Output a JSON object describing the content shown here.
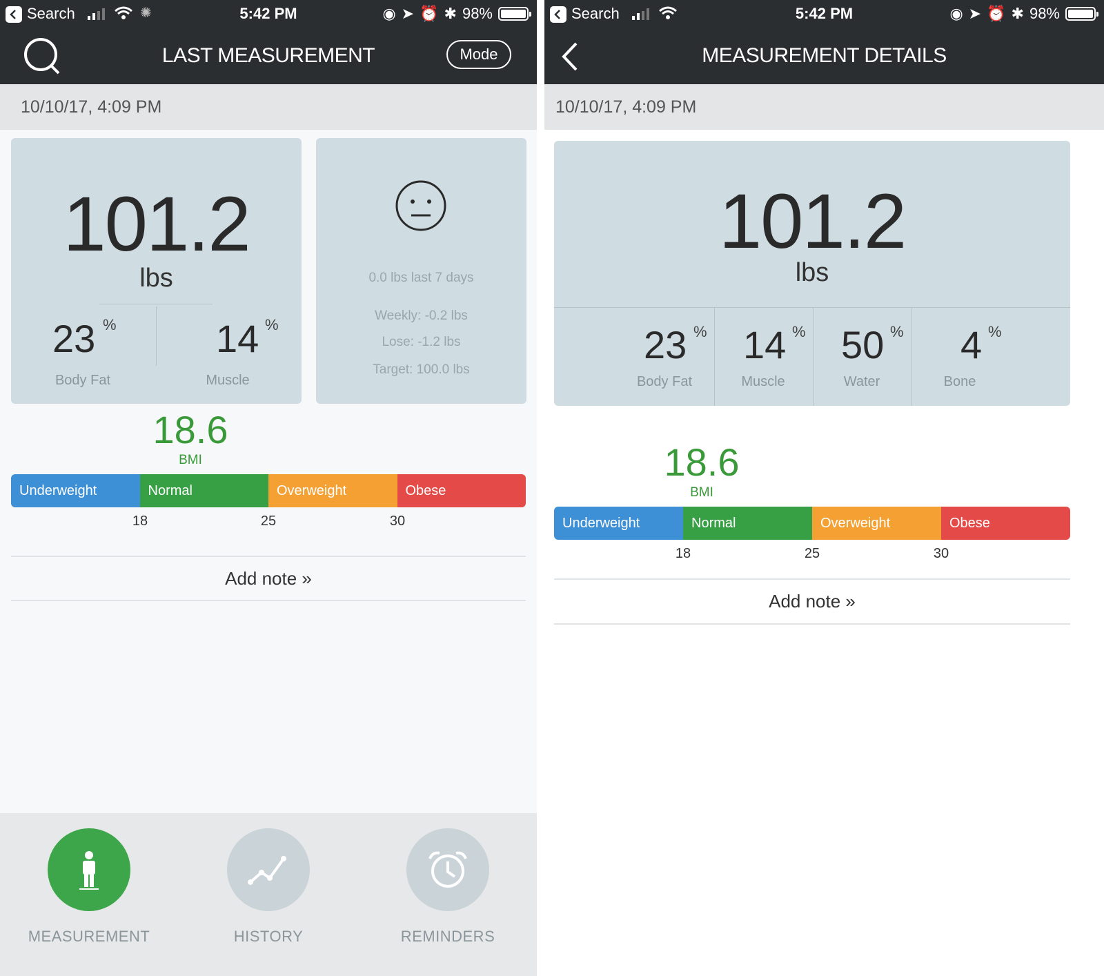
{
  "status_bar": {
    "carrier": "Search",
    "time": "5:42 PM",
    "battery": "98%",
    "battery_level": 0.98
  },
  "left": {
    "nav_title": "LAST MEASUREMENT",
    "mode_label": "Mode",
    "date": "10/10/17, 4:09 PM",
    "weight": "101.2",
    "unit": "lbs",
    "stats": [
      {
        "value": "23",
        "pct": "%",
        "label": "Body Fat"
      },
      {
        "value": "14",
        "pct": "%",
        "label": "Muscle"
      }
    ],
    "mood": {
      "change": "0.0 lbs last 7 days",
      "weekly": "Weekly: -0.2 lbs",
      "lose": "Lose: -1.2 lbs",
      "target": "Target: 100.0 lbs"
    },
    "bmi_value": "18.6",
    "bmi_label": "BMI",
    "add_note": "Add note »",
    "tabs": [
      {
        "label": "MEASUREMENT",
        "icon": "person-icon",
        "active": true
      },
      {
        "label": "HISTORY",
        "icon": "trend-line-icon",
        "active": false
      },
      {
        "label": "REMINDERS",
        "icon": "alarm-clock-icon",
        "active": false
      }
    ]
  },
  "right": {
    "nav_title": "MEASUREMENT DETAILS",
    "date": "10/10/17, 4:09 PM",
    "weight": "101.2",
    "unit": "lbs",
    "stats": [
      {
        "value": "23",
        "pct": "%",
        "label": "Body Fat"
      },
      {
        "value": "14",
        "pct": "%",
        "label": "Muscle"
      },
      {
        "value": "50",
        "pct": "%",
        "label": "Water"
      },
      {
        "value": "4",
        "pct": "%",
        "label": "Bone"
      }
    ],
    "bmi_value": "18.6",
    "bmi_label": "BMI",
    "add_note": "Add note »"
  },
  "bmi_scale": {
    "segments": [
      {
        "label": "Underweight",
        "color": "#3d8fd6"
      },
      {
        "label": "Normal",
        "color": "#37a044"
      },
      {
        "label": "Overweight",
        "color": "#f5a033"
      },
      {
        "label": "Obese",
        "color": "#e44a47"
      }
    ],
    "ticks": [
      "18",
      "25",
      "30"
    ]
  },
  "colors": {
    "nav_bg": "#2b2e31",
    "panel": "#cfdce2",
    "bmi_green": "#3a9a3a",
    "tab_active": "#3ea64a"
  }
}
